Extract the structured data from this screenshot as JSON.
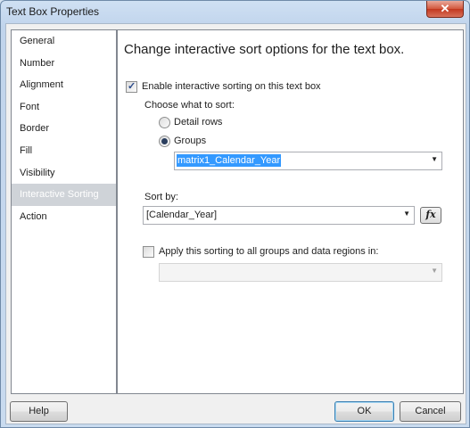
{
  "window": {
    "title": "Text Box Properties",
    "close_label": "✕"
  },
  "nav": {
    "items": [
      {
        "label": "General",
        "selected": false
      },
      {
        "label": "Number",
        "selected": false
      },
      {
        "label": "Alignment",
        "selected": false
      },
      {
        "label": "Font",
        "selected": false
      },
      {
        "label": "Border",
        "selected": false
      },
      {
        "label": "Fill",
        "selected": false
      },
      {
        "label": "Visibility",
        "selected": false
      },
      {
        "label": "Interactive Sorting",
        "selected": true
      },
      {
        "label": "Action",
        "selected": false
      }
    ]
  },
  "content": {
    "heading": "Change interactive sort options for the text box.",
    "enable_checkbox": {
      "label": "Enable interactive sorting on this text box",
      "checked": true
    },
    "choose_label": "Choose what to sort:",
    "radio_detail": {
      "label": "Detail rows",
      "selected": false
    },
    "radio_groups": {
      "label": "Groups",
      "selected": true
    },
    "group_combo": {
      "value": "matrix1_Calendar_Year"
    },
    "sort_by": {
      "label": "Sort by:",
      "value": "[Calendar_Year]",
      "fx_label": "fx"
    },
    "apply_checkbox": {
      "label": "Apply this sorting to all groups and data regions in:",
      "checked": false
    },
    "scope_combo": {
      "value": ""
    }
  },
  "footer": {
    "help_label": "Help",
    "ok_label": "OK",
    "cancel_label": "Cancel"
  },
  "colors": {
    "selection": "#3399ff",
    "nav_selected": "#cfd3d8",
    "close_button": "#c2381f"
  }
}
